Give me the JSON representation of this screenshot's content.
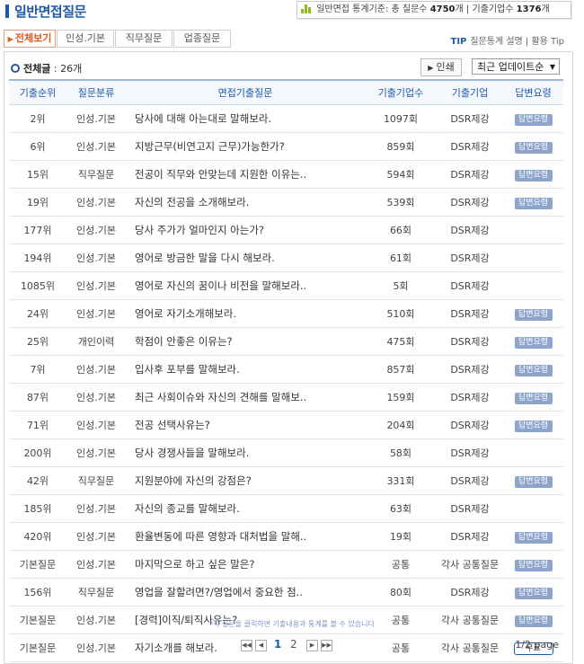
{
  "header": {
    "title": "일반면접질문",
    "stats": {
      "prefix": "일반면접 통계기준: 총 질문수",
      "question_count": "4750",
      "question_unit": "개 | 기출기업수",
      "company_count": "1376",
      "company_unit": "개"
    }
  },
  "tabs": [
    {
      "label": "전체보기",
      "active": true
    },
    {
      "label": "인성.기본"
    },
    {
      "label": "직무질문"
    },
    {
      "label": "업종질문"
    }
  ],
  "tip": {
    "label": "TIP",
    "text": "질문통계 설명 | 활용 Tip"
  },
  "list": {
    "count_label": "전체글",
    "count_value": ": 26개",
    "print_label": "인쇄",
    "sort_selected": "최근 업데이트순"
  },
  "table": {
    "headers": [
      "기출순위",
      "질문분류",
      "면접기출질문",
      "기출기업수",
      "기출기업",
      "답변요령"
    ],
    "rows": [
      {
        "rank": "2위",
        "category": "인성.기본",
        "question": "당사에 대해 아는대로 말해보라.",
        "count": "1097회",
        "company": "DSR제강",
        "answer": "답변요령"
      },
      {
        "rank": "6위",
        "category": "인성.기본",
        "question": "지방근무(비연고지 근무)가능한가?",
        "count": "859회",
        "company": "DSR제강",
        "answer": "답변요령"
      },
      {
        "rank": "15위",
        "category": "직무질문",
        "question": "전공이 직무와 안맞는데 지원한 이유는..",
        "count": "594회",
        "company": "DSR제강",
        "answer": "답변요령"
      },
      {
        "rank": "19위",
        "category": "인성.기본",
        "question": "자신의 전공을 소개해보라.",
        "count": "539회",
        "company": "DSR제강",
        "answer": "답변요령"
      },
      {
        "rank": "177위",
        "category": "인성.기본",
        "question": "당사 주가가 얼마인지 아는가?",
        "count": "66회",
        "company": "DSR제강",
        "answer": ""
      },
      {
        "rank": "194위",
        "category": "인성.기본",
        "question": "영어로 방금한 말을 다시 해보라.",
        "count": "61회",
        "company": "DSR제강",
        "answer": ""
      },
      {
        "rank": "1085위",
        "category": "인성.기본",
        "question": "영어로 자신의 꿈이나 비전을 말해보라..",
        "count": "5회",
        "company": "DSR제강",
        "answer": ""
      },
      {
        "rank": "24위",
        "category": "인성.기본",
        "question": "영어로 자기소개해보라.",
        "count": "510회",
        "company": "DSR제강",
        "answer": "답변요령"
      },
      {
        "rank": "25위",
        "category": "개인이력",
        "question": "학점이 안좋은 이유는?",
        "count": "475회",
        "company": "DSR제강",
        "answer": "답변요령"
      },
      {
        "rank": "7위",
        "category": "인성.기본",
        "question": "입사후 포부를 말해보라.",
        "count": "857회",
        "company": "DSR제강",
        "answer": "답변요령"
      },
      {
        "rank": "87위",
        "category": "인성.기본",
        "question": "최근 사회이슈와 자신의 견해를 말해보..",
        "count": "159회",
        "company": "DSR제강",
        "answer": "답변요령"
      },
      {
        "rank": "71위",
        "category": "인성.기본",
        "question": "전공 선택사유는?",
        "count": "204회",
        "company": "DSR제강",
        "answer": "답변요령"
      },
      {
        "rank": "200위",
        "category": "인성.기본",
        "question": "당사 경쟁사들을 말해보라.",
        "count": "58회",
        "company": "DSR제강",
        "answer": ""
      },
      {
        "rank": "42위",
        "category": "직무질문",
        "question": "지원분야에 자신의 강점은?",
        "count": "331회",
        "company": "DSR제강",
        "answer": "답변요령"
      },
      {
        "rank": "185위",
        "category": "인성.기본",
        "question": "자신의 종교를 말해보라.",
        "count": "63회",
        "company": "DSR제강",
        "answer": ""
      },
      {
        "rank": "420위",
        "category": "인성.기본",
        "question": "환율변동에 따른 영향과 대처법을 말해..",
        "count": "19회",
        "company": "DSR제강",
        "answer": "답변요령"
      },
      {
        "rank": "기본질문",
        "category": "인성.기본",
        "question": "마지막으로 하고 싶은 말은?",
        "count": "공통",
        "company": "각사 공통질문",
        "answer": "답변요령"
      },
      {
        "rank": "156위",
        "category": "직무질문",
        "question": "영업을 잘할려면?/영업에서 중요한 점..",
        "count": "80회",
        "company": "DSR제강",
        "answer": "답변요령"
      },
      {
        "rank": "기본질문",
        "category": "인성.기본",
        "question": "[경력]이직/퇴직사유는?",
        "count": "공통",
        "company": "각사 공통질문",
        "answer": "답변요령"
      },
      {
        "rank": "기본질문",
        "category": "인성.기본",
        "question": "자기소개를 해보라.",
        "count": "공통",
        "company": "각사 공통질문",
        "answer": "무료",
        "answer_free": true
      }
    ]
  },
  "note": "*각 질문을 클릭하면 기출내용과 통계를 볼 수 있습니다",
  "pagination": {
    "pages": [
      "1",
      "2"
    ],
    "current": "1",
    "info": "1/2 page"
  },
  "colors": {
    "accent": "#1d5aa8",
    "active_tab": "#e2561f",
    "badge": "#8da4cd"
  }
}
